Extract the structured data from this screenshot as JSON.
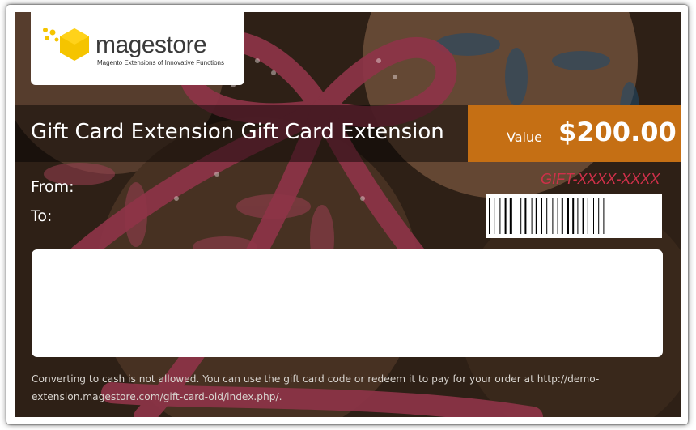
{
  "logo": {
    "name": "magestore",
    "tagline": "Magento Extensions of Innovative Functions"
  },
  "card": {
    "title": "Gift Card Extension Gift Card Extension",
    "value_label": "Value",
    "value_amount": "$200.00",
    "gift_code": "GIFT-XXXX-XXXX",
    "from_label": "From:",
    "to_label": "To:",
    "message": "",
    "notes": "Converting to cash is not allowed. You can use the gift card code or redeem it to pay for your order at http://demo-extension.magestore.com/gift-card-old/index.php/."
  },
  "colors": {
    "value_box": "#c56f14",
    "gift_code": "#d0304a",
    "logo_hex": "#f5c400",
    "background": "#3a271b"
  }
}
